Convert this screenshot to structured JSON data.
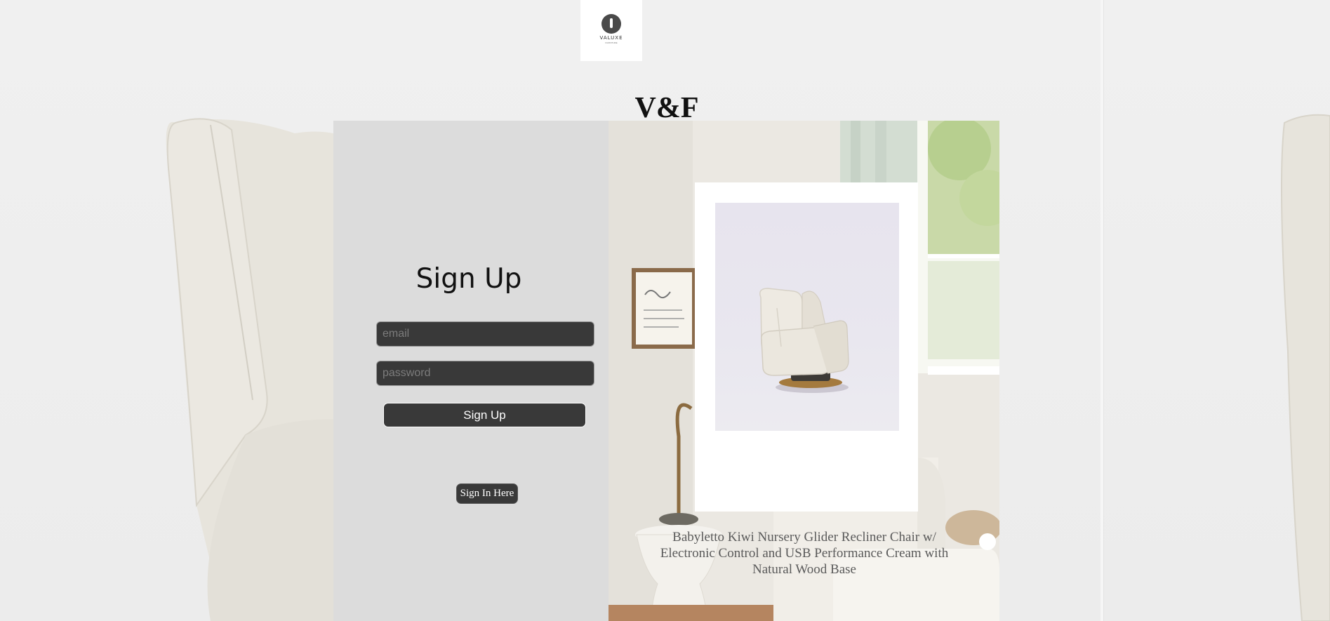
{
  "header": {
    "logo": {
      "icon": "valuxe-logo-icon",
      "wordmark": "VALUXE",
      "tagline": "FURNITURE"
    },
    "brand_title": "V&F"
  },
  "signup_form": {
    "heading": "Sign Up",
    "email_field": {
      "placeholder": "email",
      "value": ""
    },
    "password_field": {
      "placeholder": "password",
      "value": ""
    },
    "submit_label": "Sign Up",
    "signin_link_label": "Sign In Here"
  },
  "product": {
    "image_icon": "recliner-chair-image",
    "caption": "Babyletto Kiwi Nursery Glider Recliner Chair w/ Electronic Control and USB Performance Cream with Natural Wood Base"
  },
  "colors": {
    "page_background": "#efefef",
    "form_panel": "#dcdcdc",
    "control_dark": "#393939",
    "card_background": "#ffffff",
    "caption_text": "#5a5a5a"
  }
}
